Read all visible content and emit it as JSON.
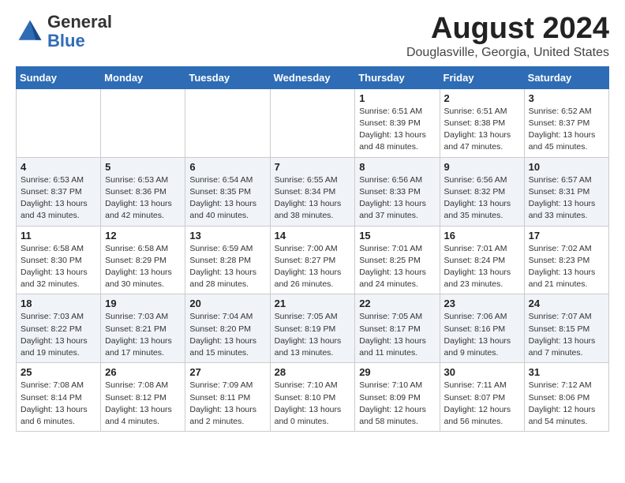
{
  "header": {
    "logo_general": "General",
    "logo_blue": "Blue",
    "month_title": "August 2024",
    "subtitle": "Douglasville, Georgia, United States"
  },
  "calendar": {
    "days_of_week": [
      "Sunday",
      "Monday",
      "Tuesday",
      "Wednesday",
      "Thursday",
      "Friday",
      "Saturday"
    ],
    "weeks": [
      [
        {
          "day": "",
          "info": ""
        },
        {
          "day": "",
          "info": ""
        },
        {
          "day": "",
          "info": ""
        },
        {
          "day": "",
          "info": ""
        },
        {
          "day": "1",
          "info": "Sunrise: 6:51 AM\nSunset: 8:39 PM\nDaylight: 13 hours\nand 48 minutes."
        },
        {
          "day": "2",
          "info": "Sunrise: 6:51 AM\nSunset: 8:38 PM\nDaylight: 13 hours\nand 47 minutes."
        },
        {
          "day": "3",
          "info": "Sunrise: 6:52 AM\nSunset: 8:37 PM\nDaylight: 13 hours\nand 45 minutes."
        }
      ],
      [
        {
          "day": "4",
          "info": "Sunrise: 6:53 AM\nSunset: 8:37 PM\nDaylight: 13 hours\nand 43 minutes."
        },
        {
          "day": "5",
          "info": "Sunrise: 6:53 AM\nSunset: 8:36 PM\nDaylight: 13 hours\nand 42 minutes."
        },
        {
          "day": "6",
          "info": "Sunrise: 6:54 AM\nSunset: 8:35 PM\nDaylight: 13 hours\nand 40 minutes."
        },
        {
          "day": "7",
          "info": "Sunrise: 6:55 AM\nSunset: 8:34 PM\nDaylight: 13 hours\nand 38 minutes."
        },
        {
          "day": "8",
          "info": "Sunrise: 6:56 AM\nSunset: 8:33 PM\nDaylight: 13 hours\nand 37 minutes."
        },
        {
          "day": "9",
          "info": "Sunrise: 6:56 AM\nSunset: 8:32 PM\nDaylight: 13 hours\nand 35 minutes."
        },
        {
          "day": "10",
          "info": "Sunrise: 6:57 AM\nSunset: 8:31 PM\nDaylight: 13 hours\nand 33 minutes."
        }
      ],
      [
        {
          "day": "11",
          "info": "Sunrise: 6:58 AM\nSunset: 8:30 PM\nDaylight: 13 hours\nand 32 minutes."
        },
        {
          "day": "12",
          "info": "Sunrise: 6:58 AM\nSunset: 8:29 PM\nDaylight: 13 hours\nand 30 minutes."
        },
        {
          "day": "13",
          "info": "Sunrise: 6:59 AM\nSunset: 8:28 PM\nDaylight: 13 hours\nand 28 minutes."
        },
        {
          "day": "14",
          "info": "Sunrise: 7:00 AM\nSunset: 8:27 PM\nDaylight: 13 hours\nand 26 minutes."
        },
        {
          "day": "15",
          "info": "Sunrise: 7:01 AM\nSunset: 8:25 PM\nDaylight: 13 hours\nand 24 minutes."
        },
        {
          "day": "16",
          "info": "Sunrise: 7:01 AM\nSunset: 8:24 PM\nDaylight: 13 hours\nand 23 minutes."
        },
        {
          "day": "17",
          "info": "Sunrise: 7:02 AM\nSunset: 8:23 PM\nDaylight: 13 hours\nand 21 minutes."
        }
      ],
      [
        {
          "day": "18",
          "info": "Sunrise: 7:03 AM\nSunset: 8:22 PM\nDaylight: 13 hours\nand 19 minutes."
        },
        {
          "day": "19",
          "info": "Sunrise: 7:03 AM\nSunset: 8:21 PM\nDaylight: 13 hours\nand 17 minutes."
        },
        {
          "day": "20",
          "info": "Sunrise: 7:04 AM\nSunset: 8:20 PM\nDaylight: 13 hours\nand 15 minutes."
        },
        {
          "day": "21",
          "info": "Sunrise: 7:05 AM\nSunset: 8:19 PM\nDaylight: 13 hours\nand 13 minutes."
        },
        {
          "day": "22",
          "info": "Sunrise: 7:05 AM\nSunset: 8:17 PM\nDaylight: 13 hours\nand 11 minutes."
        },
        {
          "day": "23",
          "info": "Sunrise: 7:06 AM\nSunset: 8:16 PM\nDaylight: 13 hours\nand 9 minutes."
        },
        {
          "day": "24",
          "info": "Sunrise: 7:07 AM\nSunset: 8:15 PM\nDaylight: 13 hours\nand 7 minutes."
        }
      ],
      [
        {
          "day": "25",
          "info": "Sunrise: 7:08 AM\nSunset: 8:14 PM\nDaylight: 13 hours\nand 6 minutes."
        },
        {
          "day": "26",
          "info": "Sunrise: 7:08 AM\nSunset: 8:12 PM\nDaylight: 13 hours\nand 4 minutes."
        },
        {
          "day": "27",
          "info": "Sunrise: 7:09 AM\nSunset: 8:11 PM\nDaylight: 13 hours\nand 2 minutes."
        },
        {
          "day": "28",
          "info": "Sunrise: 7:10 AM\nSunset: 8:10 PM\nDaylight: 13 hours\nand 0 minutes."
        },
        {
          "day": "29",
          "info": "Sunrise: 7:10 AM\nSunset: 8:09 PM\nDaylight: 12 hours\nand 58 minutes."
        },
        {
          "day": "30",
          "info": "Sunrise: 7:11 AM\nSunset: 8:07 PM\nDaylight: 12 hours\nand 56 minutes."
        },
        {
          "day": "31",
          "info": "Sunrise: 7:12 AM\nSunset: 8:06 PM\nDaylight: 12 hours\nand 54 minutes."
        }
      ]
    ]
  }
}
